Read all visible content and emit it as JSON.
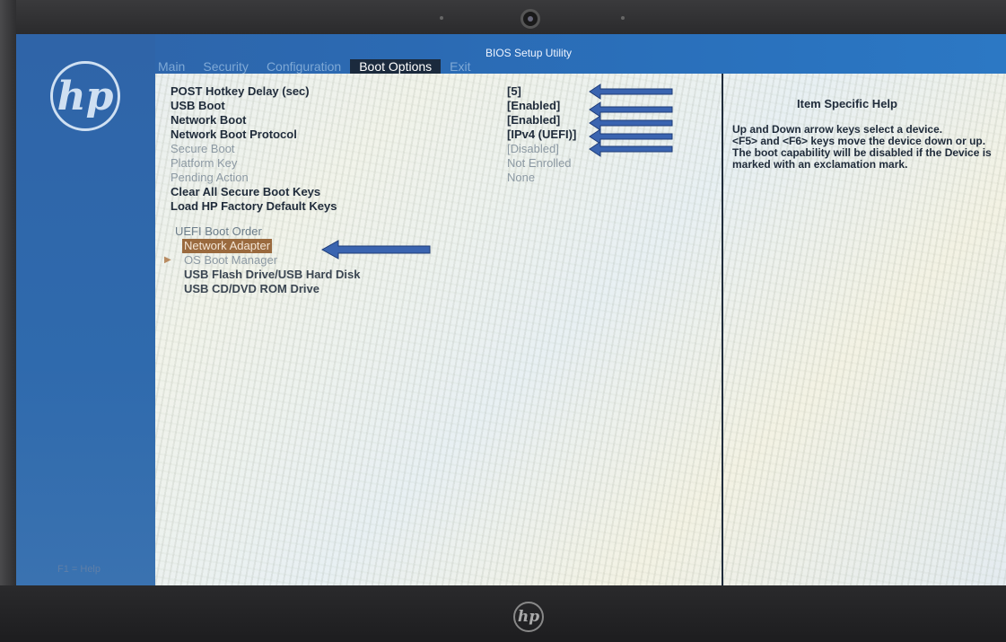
{
  "bios": {
    "title": "BIOS Setup Utility",
    "logo": "hp",
    "menu": [
      "Main",
      "Security",
      "Configuration",
      "Boot Options",
      "Exit"
    ],
    "active_menu": "Boot Options"
  },
  "settings": [
    {
      "label": "POST Hotkey Delay (sec)",
      "value": "[5]",
      "enabled": true
    },
    {
      "label": "USB Boot",
      "value": "[Enabled]",
      "enabled": true
    },
    {
      "label": "Network Boot",
      "value": "[Enabled]",
      "enabled": true
    },
    {
      "label": "Network Boot Protocol",
      "value": "[IPv4 (UEFI)]",
      "enabled": true
    },
    {
      "label": "Secure Boot",
      "value": "[Disabled]",
      "enabled": false
    },
    {
      "label": "Platform Key",
      "value": "Not Enrolled",
      "enabled": false
    },
    {
      "label": "Pending Action",
      "value": "None",
      "enabled": false
    },
    {
      "label": "Clear All Secure Boot Keys",
      "value": "",
      "enabled": true
    },
    {
      "label": "Load HP Factory Default Keys",
      "value": "",
      "enabled": true
    }
  ],
  "boot_order": {
    "title": "UEFI Boot Order",
    "devices": [
      "Network Adapter",
      "OS Boot Manager",
      "USB Flash Drive/USB Hard Disk",
      "USB CD/DVD ROM Drive"
    ],
    "selected": "Network Adapter"
  },
  "help": {
    "title": "Item Specific Help",
    "text": "Up and Down arrow keys select a device.\n<F5> and <F6> keys move the device down or up.\nThe boot capability will be disabled if the Device is marked with an exclamation mark."
  },
  "footer": {
    "f1": "F1 = Help"
  },
  "annotation_color": "#3a64b0",
  "bezel_logo": "hp"
}
